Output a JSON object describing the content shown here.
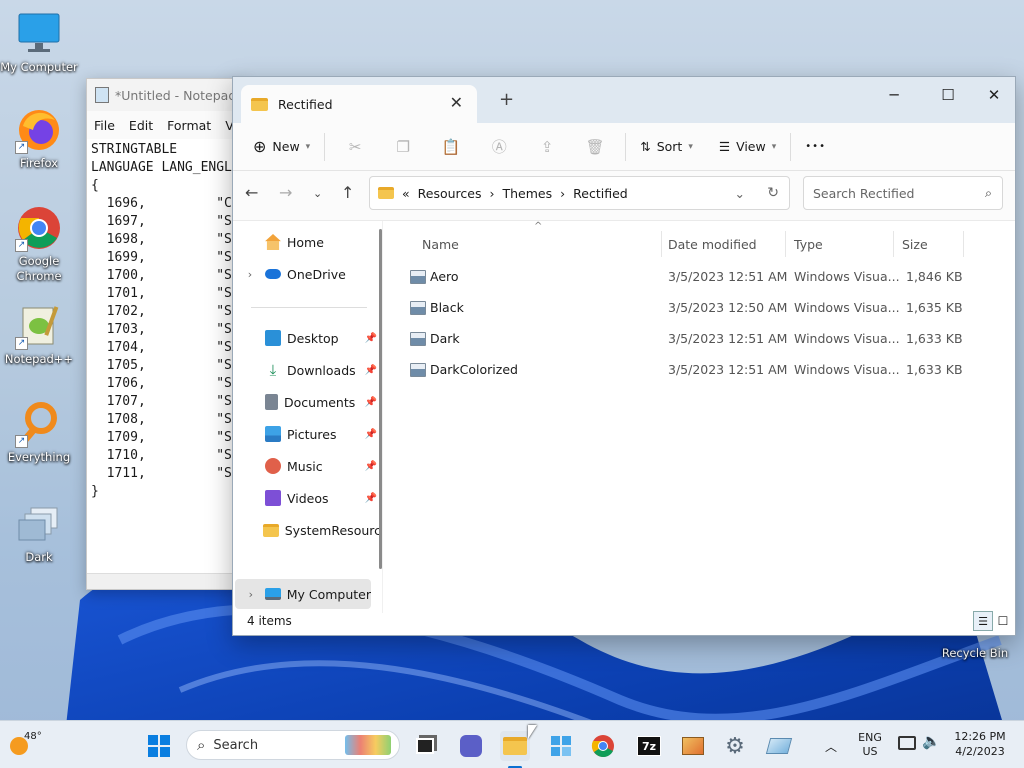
{
  "desktop": {
    "icons": [
      {
        "label": "My Computer"
      },
      {
        "label": "Firefox"
      },
      {
        "label": "Google Chrome"
      },
      {
        "label": "Notepad++"
      },
      {
        "label": "Everything"
      },
      {
        "label": "Dark"
      },
      {
        "label": "Recycle Bin"
      }
    ]
  },
  "notepad": {
    "title": "*Untitled - Notepad",
    "menu": [
      "File",
      "Edit",
      "Format",
      "Vi"
    ],
    "lines": [
      "STRINGTABLE",
      "LANGUAGE LANG_ENGL",
      "{",
      "  1696,         \"C",
      "  1697,         \"S",
      "  1698,         \"S",
      "  1699,         \"S",
      "  1700,         \"S",
      "  1701,         \"S",
      "  1702,         \"S",
      "  1703,         \"S",
      "  1704,         \"S",
      "  1705,         \"S",
      "  1706,         \"S",
      "  1707,         \"S",
      "  1708,         \"S",
      "  1709,         \"S",
      "  1710,         \"S",
      "  1711,         \"S",
      "}"
    ]
  },
  "explorer": {
    "tab_title": "Rectified",
    "toolbar": {
      "new": "New",
      "sort": "Sort",
      "view": "View",
      "more": "•••"
    },
    "breadcrumb": {
      "prefix": "«",
      "items": [
        "Resources",
        "Themes",
        "Rectified"
      ]
    },
    "search_placeholder": "Search Rectified",
    "nav": {
      "home": "Home",
      "onedrive": "OneDrive",
      "desktop": "Desktop",
      "downloads": "Downloads",
      "documents": "Documents",
      "pictures": "Pictures",
      "music": "Music",
      "videos": "Videos",
      "systemresources": "SystemResourc",
      "mycomputer": "My Computer"
    },
    "columns": {
      "name": "Name",
      "date": "Date modified",
      "type": "Type",
      "size": "Size"
    },
    "files": [
      {
        "name": "Aero",
        "date": "3/5/2023 12:51 AM",
        "type": "Windows Visua...",
        "size": "1,846 KB"
      },
      {
        "name": "Black",
        "date": "3/5/2023 12:50 AM",
        "type": "Windows Visua...",
        "size": "1,635 KB"
      },
      {
        "name": "Dark",
        "date": "3/5/2023 12:51 AM",
        "type": "Windows Visua...",
        "size": "1,633 KB"
      },
      {
        "name": "DarkColorized",
        "date": "3/5/2023 12:51 AM",
        "type": "Windows Visua...",
        "size": "1,633 KB"
      }
    ],
    "status": "4 items"
  },
  "taskbar": {
    "weather": "48°",
    "search": "Search",
    "lang": "ENG",
    "region": "US",
    "time": "12:26 PM",
    "date": "4/2/2023"
  }
}
